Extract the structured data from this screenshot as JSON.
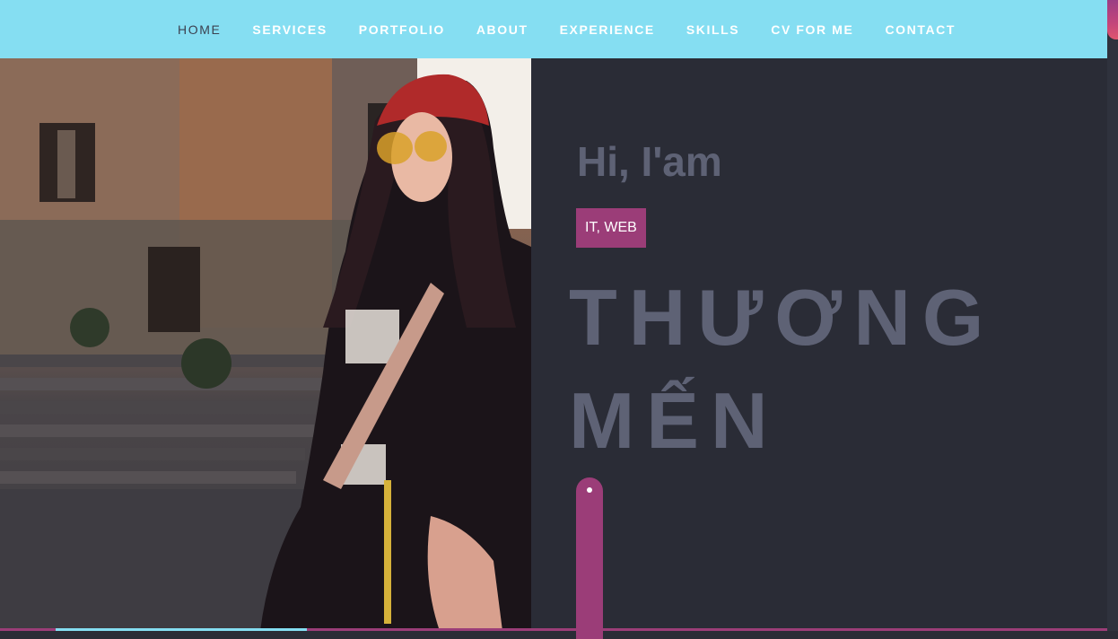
{
  "nav": {
    "items": [
      {
        "label": "HOME",
        "active": true
      },
      {
        "label": "SERVICES",
        "active": false
      },
      {
        "label": "PORTFOLIO",
        "active": false
      },
      {
        "label": "ABOUT",
        "active": false
      },
      {
        "label": "EXPERIENCE",
        "active": false
      },
      {
        "label": "SKILLS",
        "active": false
      },
      {
        "label": "CV FOR ME",
        "active": false
      },
      {
        "label": "CONTACT",
        "active": false
      }
    ]
  },
  "hero": {
    "greeting": "Hi, I'am",
    "role": "IT, WEB",
    "name_line1": "THƯƠNG",
    "name_line2": "MẾN",
    "photo_subject": "woman-street-photo"
  },
  "colors": {
    "navbar": "#85def2",
    "accent": "#9b3d78",
    "panel": "#2a2c36",
    "heading": "#5e6275"
  }
}
